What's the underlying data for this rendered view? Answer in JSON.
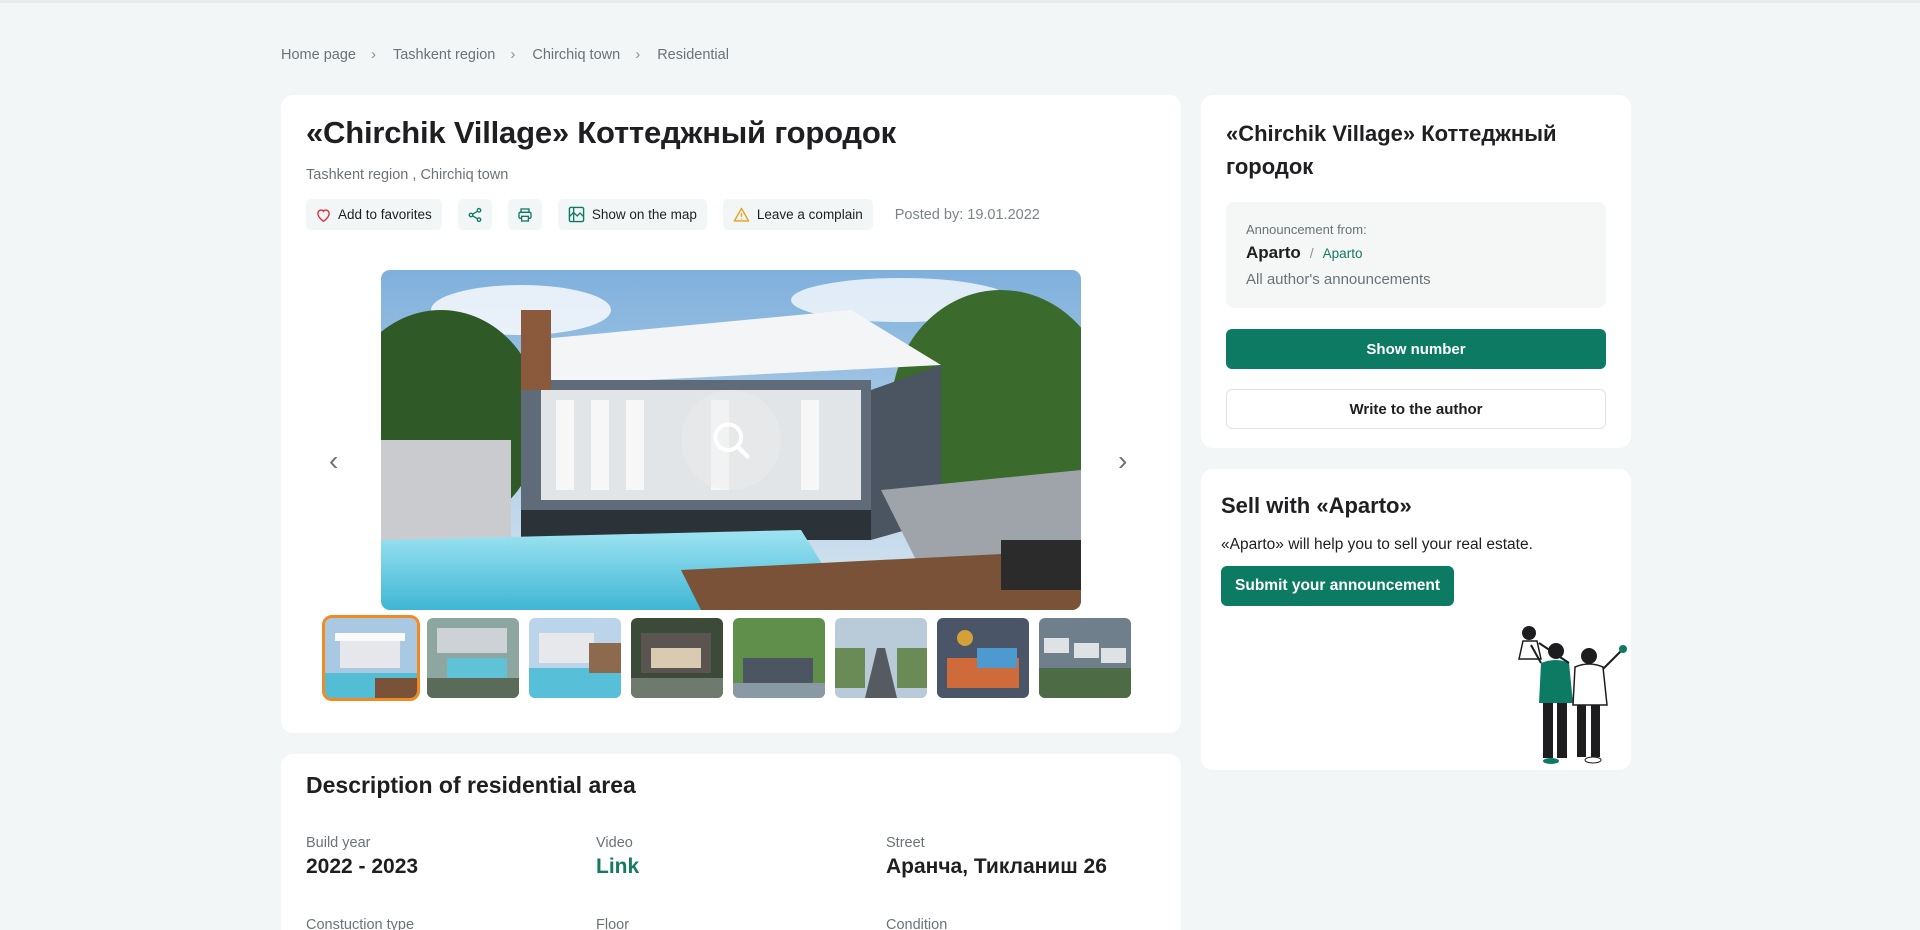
{
  "breadcrumb": [
    "Home page",
    "Tashkent region",
    "Chirchiq town",
    "Residential"
  ],
  "listing": {
    "title": "«Chirchik Village» Коттеджный городок",
    "location": "Tashkent region , Chirchiq town",
    "actions": {
      "favorites": "Add to favorites",
      "map": "Show on the map",
      "complain": "Leave a complain"
    },
    "posted": "Posted by: 19.01.2022",
    "gallery": {
      "active_index": 0,
      "thumb_count": 8
    }
  },
  "description": {
    "title": "Description of residential area",
    "fields": [
      {
        "label": "Build year",
        "value": "2022 - 2023"
      },
      {
        "label": "Video",
        "value": "Link"
      },
      {
        "label": "Street",
        "value": "Аранча, Тикланиш 26"
      },
      {
        "label": "Constuction type",
        "value": ""
      },
      {
        "label": "Floor",
        "value": ""
      },
      {
        "label": "Condition",
        "value": ""
      }
    ]
  },
  "author": {
    "title": "«Chirchik Village» Коттеджный городок",
    "from_label": "Announcement from:",
    "name": "Aparto",
    "sub": "Aparto",
    "all": "All author's announcements",
    "show_number": "Show number",
    "write": "Write to the author"
  },
  "sell": {
    "title": "Sell with «Aparto»",
    "text": "«Aparto» will help you to sell your real estate.",
    "button": "Submit your announcement"
  },
  "colors": {
    "accent": "#0d7b63",
    "active_thumb": "#f08a24",
    "background": "#f3f6f6"
  }
}
